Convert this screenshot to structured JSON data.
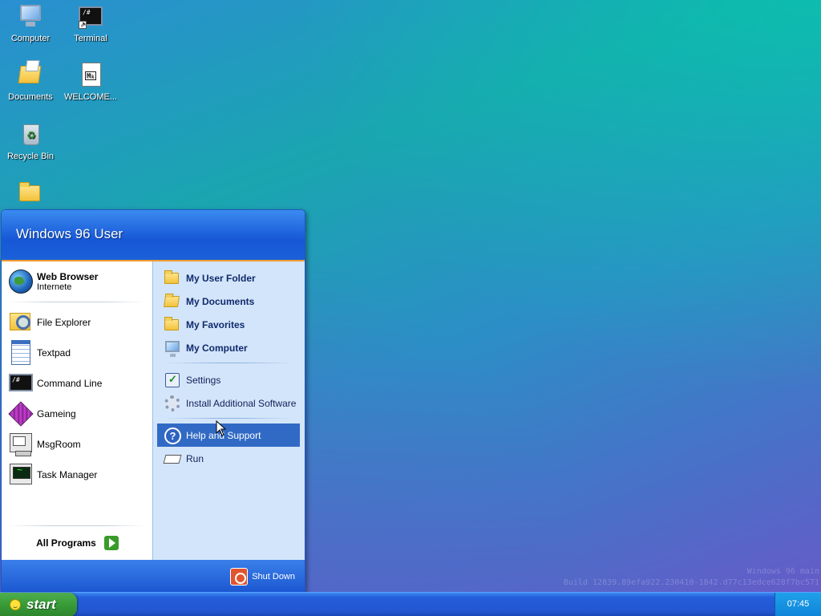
{
  "desktop": {
    "icons": [
      {
        "label": "Computer",
        "icon": "computer-icon"
      },
      {
        "label": "Terminal",
        "icon": "terminal-icon"
      },
      {
        "label": "Documents",
        "icon": "documents-icon"
      },
      {
        "label": "WELCOME...",
        "icon": "markdown-file-icon"
      },
      {
        "label": "Recycle Bin",
        "icon": "recycle-bin-icon"
      },
      {
        "label": "",
        "icon": "folder-icon"
      }
    ],
    "terminal_glyph": "/#",
    "watermark": {
      "line1": "Windows 96 main",
      "line2": "Build 12839.89efa922.230410-1842.d77c13edce628f7bc571"
    }
  },
  "start_menu": {
    "user_name": "Windows 96 User",
    "pinned": {
      "label": "Web Browser",
      "sub": "Internete",
      "icon": "globe-icon"
    },
    "left_items": [
      {
        "label": "File Explorer",
        "icon": "file-explorer-icon"
      },
      {
        "label": "Textpad",
        "icon": "notepad-icon"
      },
      {
        "label": "Command Line",
        "icon": "terminal-icon"
      },
      {
        "label": "Gameing",
        "icon": "cube-icon"
      },
      {
        "label": "MsgRoom",
        "icon": "msgroom-icon"
      },
      {
        "label": "Task Manager",
        "icon": "task-manager-icon"
      }
    ],
    "all_programs": "All Programs",
    "right_places": [
      {
        "label": "My User Folder",
        "icon": "folder-icon"
      },
      {
        "label": "My Documents",
        "icon": "documents-icon"
      },
      {
        "label": "My Favorites",
        "icon": "folder-icon"
      },
      {
        "label": "My Computer",
        "icon": "computer-icon"
      }
    ],
    "right_system": [
      {
        "label": "Settings",
        "icon": "settings-icon"
      },
      {
        "label": "Install Additional Software",
        "icon": "gear-icon"
      }
    ],
    "right_tools": [
      {
        "label": "Help and Support",
        "icon": "help-icon",
        "highlighted": true
      },
      {
        "label": "Run",
        "icon": "run-icon"
      }
    ],
    "shutdown": "Shut Down"
  },
  "taskbar": {
    "start_label": "start",
    "clock": "07:45"
  },
  "colors": {
    "highlight": "#316ac5",
    "start_green": "#379b37",
    "taskbar_blue": "#245edb",
    "menu_header": "#1757d6",
    "menu_right_panel": "#d3e5fa"
  }
}
